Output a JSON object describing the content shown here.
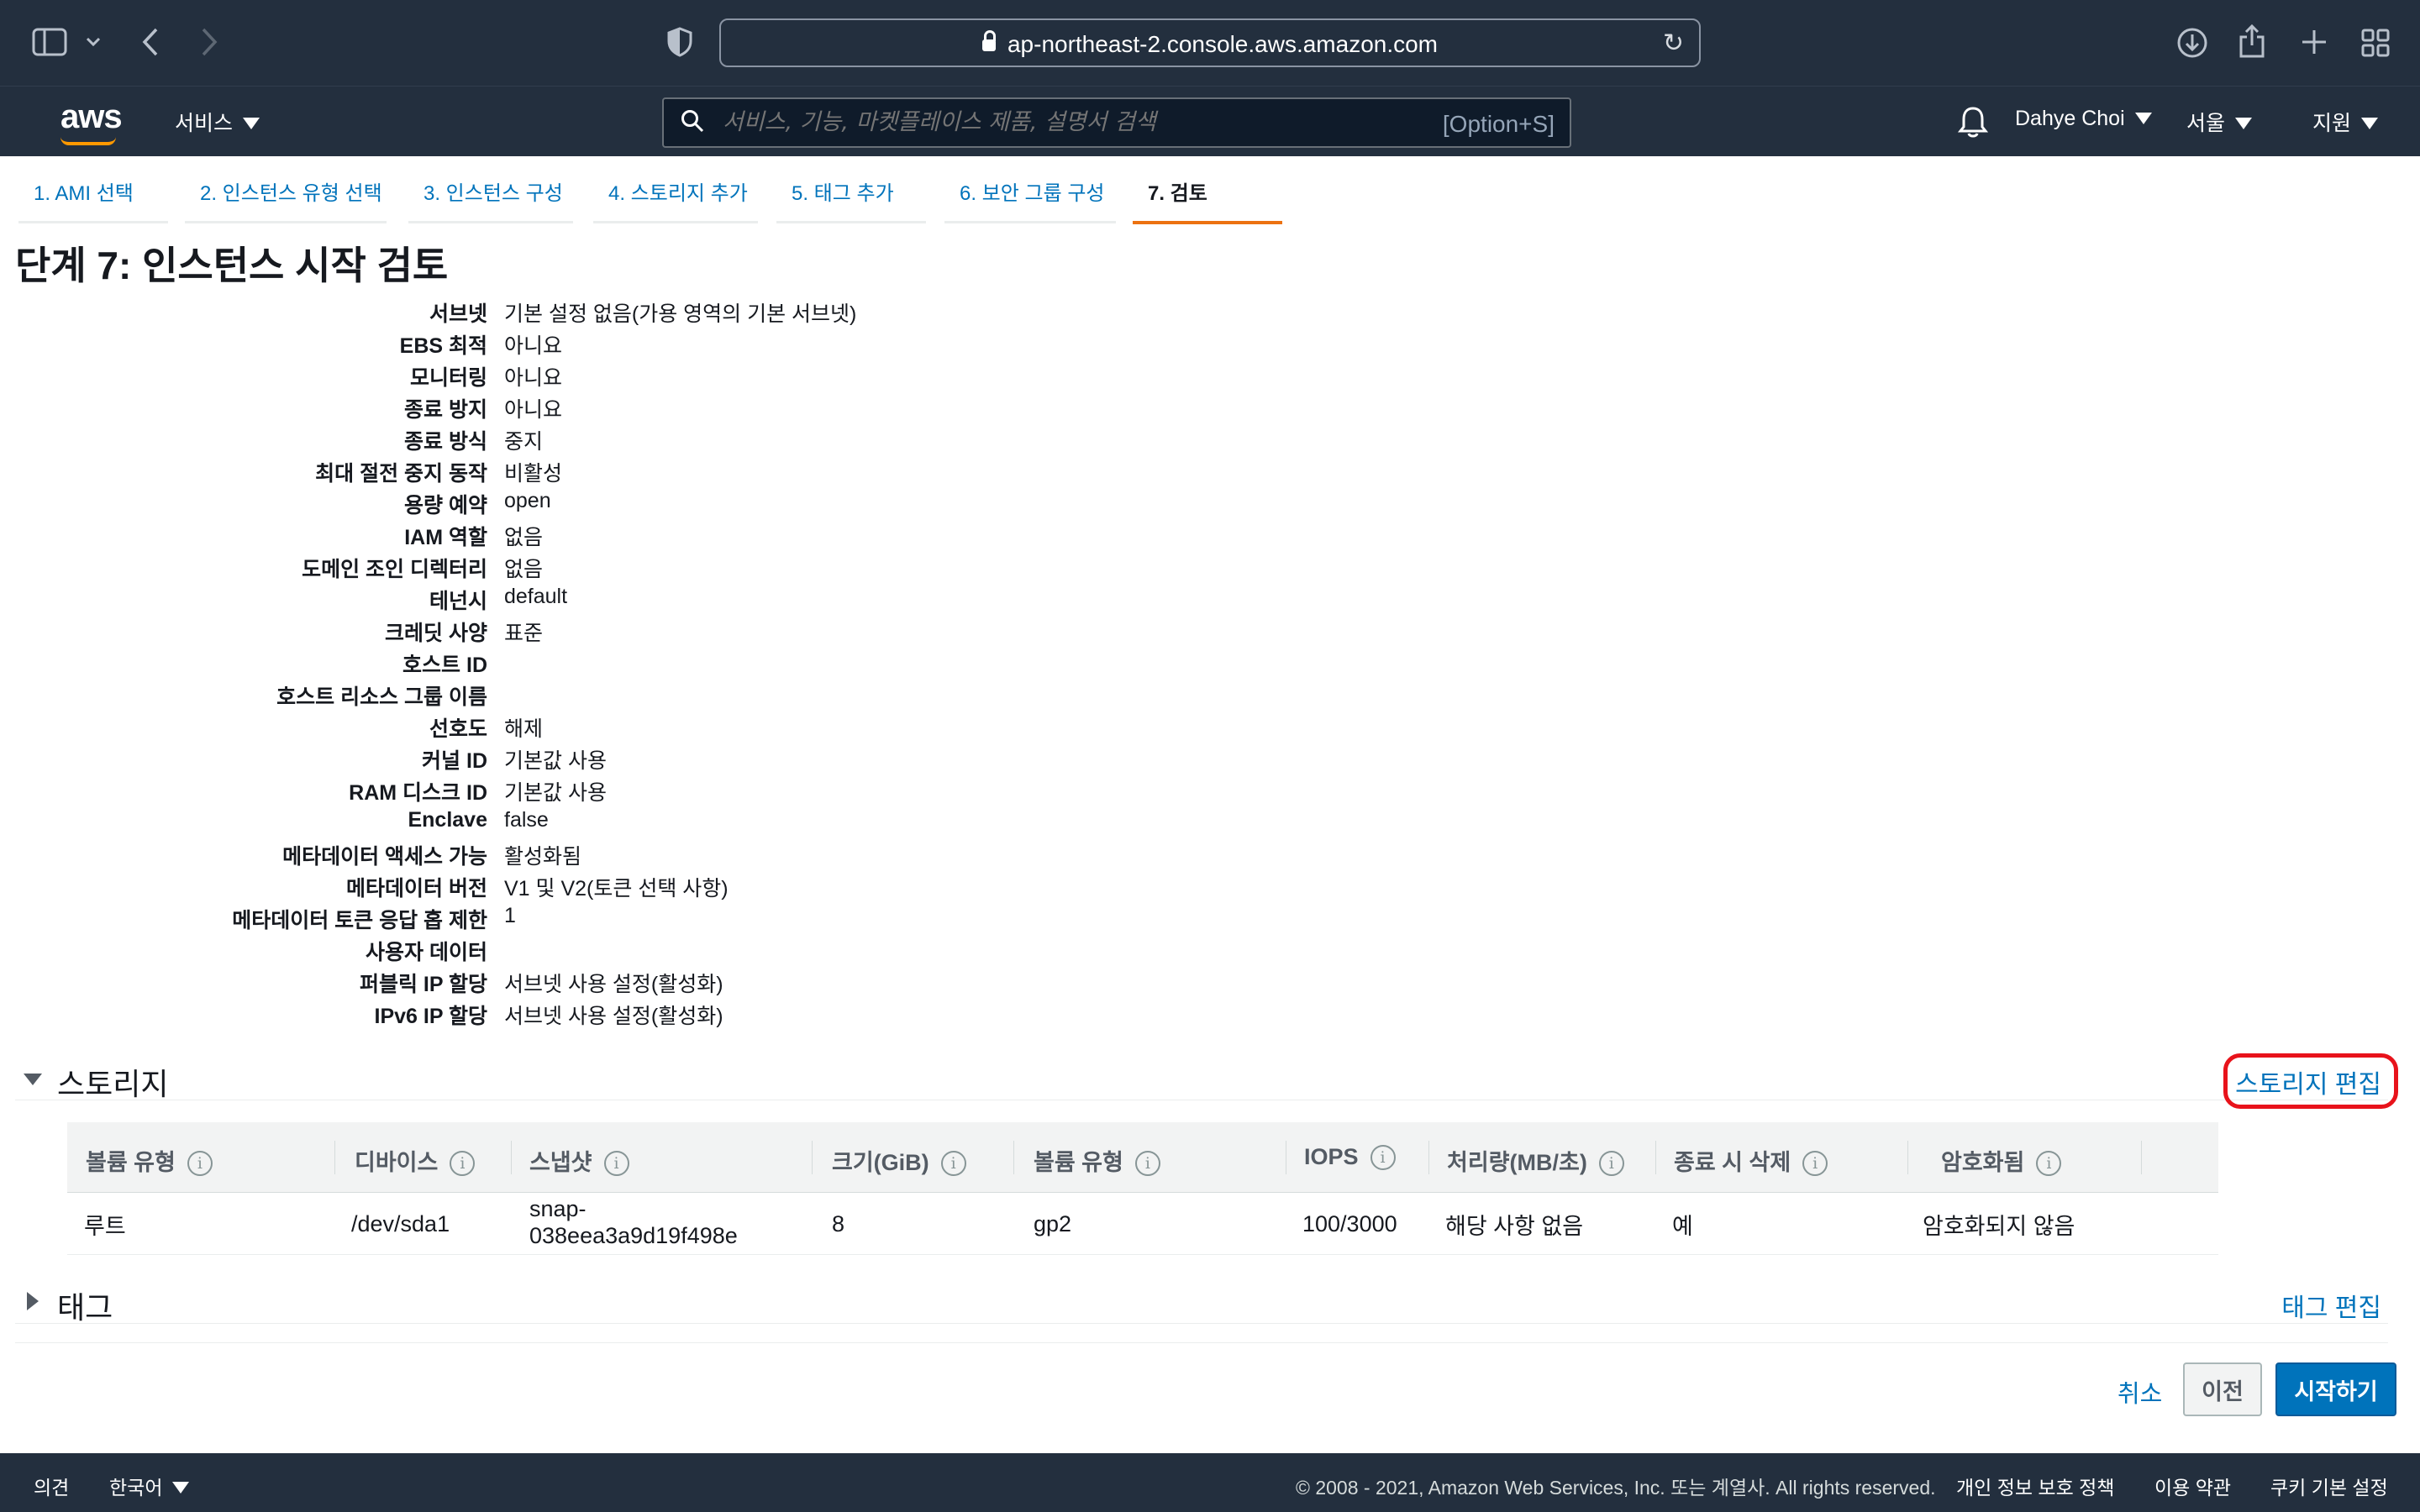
{
  "browser": {
    "url": "ap-northeast-2.console.aws.amazon.com"
  },
  "nav": {
    "logo": "aws",
    "services": "서비스",
    "search_placeholder": "서비스, 기능, 마켓플레이스 제품, 설명서 검색",
    "search_shortcut": "[Option+S]",
    "user": "Dahye Choi",
    "region": "서울",
    "support": "지원"
  },
  "steps": [
    "1. AMI 선택",
    "2. 인스턴스 유형 선택",
    "3. 인스턴스 구성",
    "4. 스토리지 추가",
    "5. 태그 추가",
    "6. 보안 그룹 구성",
    "7. 검토"
  ],
  "page_title": "단계 7: 인스턴스 시작 검토",
  "details": [
    {
      "k": "서브넷",
      "v": "기본 설정 없음(가용 영역의 기본 서브넷)"
    },
    {
      "k": "EBS 최적",
      "v": "아니요"
    },
    {
      "k": "모니터링",
      "v": "아니요"
    },
    {
      "k": "종료 방지",
      "v": "아니요"
    },
    {
      "k": "종료 방식",
      "v": "중지"
    },
    {
      "k": "최대 절전 중지 동작",
      "v": "비활성"
    },
    {
      "k": "용량 예약",
      "v": "open"
    },
    {
      "k": "IAM 역할",
      "v": "없음"
    },
    {
      "k": "도메인 조인 디렉터리",
      "v": "없음"
    },
    {
      "k": "테넌시",
      "v": "default"
    },
    {
      "k": "크레딧 사양",
      "v": "표준"
    },
    {
      "k": "호스트 ID",
      "v": ""
    },
    {
      "k": "호스트 리소스 그룹 이름",
      "v": ""
    },
    {
      "k": "선호도",
      "v": "해제"
    },
    {
      "k": "커널 ID",
      "v": "기본값 사용"
    },
    {
      "k": "RAM 디스크 ID",
      "v": "기본값 사용"
    },
    {
      "k": "Enclave",
      "v": "false"
    },
    {
      "k": "메타데이터 액세스 가능",
      "v": "활성화됨"
    },
    {
      "k": "메타데이터 버전",
      "v": "V1 및 V2(토큰 선택 사항)"
    },
    {
      "k": "메타데이터 토큰 응답 홉 제한",
      "v": "1"
    },
    {
      "k": "사용자 데이터",
      "v": ""
    },
    {
      "k": "퍼블릭 IP 할당",
      "v": "서브넷 사용 설정(활성화)"
    },
    {
      "k": "IPv6 IP 할당",
      "v": "서브넷 사용 설정(활성화)"
    }
  ],
  "storage": {
    "title": "스토리지",
    "edit_link": "스토리지 편집",
    "columns": [
      "볼륨 유형",
      "디바이스",
      "스냅샷",
      "크기(GiB)",
      "볼륨 유형",
      "IOPS",
      "처리량(MB/초)",
      "종료 시 삭제",
      "암호화됨"
    ],
    "rows": [
      {
        "volume_type": "루트",
        "device": "/dev/sda1",
        "snapshot_1": "snap-",
        "snapshot_2": "038eea3a9d19f498e",
        "size": "8",
        "ebs_type": "gp2",
        "iops": "100/3000",
        "throughput": "해당 사항 없음",
        "delete_on_termination": "예",
        "encrypted": "암호화되지 않음"
      }
    ]
  },
  "tags": {
    "title": "태그",
    "edit_link": "태그 편집"
  },
  "actions": {
    "cancel": "취소",
    "previous": "이전",
    "launch": "시작하기"
  },
  "footer": {
    "feedback": "의견",
    "language": "한국어",
    "copyright": "© 2008 - 2021, Amazon Web Services, Inc. 또는 계열사. All rights reserved.",
    "privacy": "개인 정보 보호 정책",
    "terms": "이용 약관",
    "cookies": "쿠키 기본 설정"
  }
}
